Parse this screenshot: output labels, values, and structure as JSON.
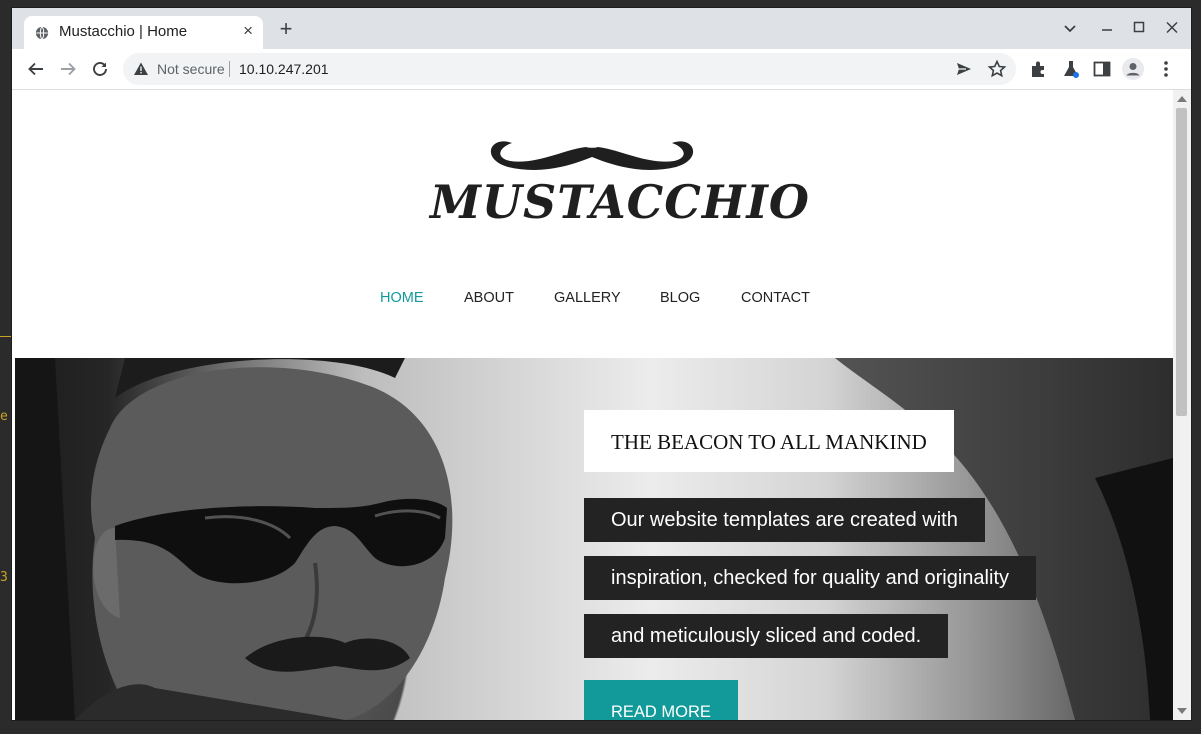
{
  "browser": {
    "tab_title": "Mustacchio | Home",
    "tab_close": "×",
    "new_tab": "+",
    "security_label": "Not secure",
    "url": "10.10.247.201"
  },
  "site": {
    "logo_text": "MUSTACCHIO",
    "nav": [
      {
        "label": "HOME",
        "active": true
      },
      {
        "label": "ABOUT",
        "active": false
      },
      {
        "label": "GALLERY",
        "active": false
      },
      {
        "label": "BLOG",
        "active": false
      },
      {
        "label": "CONTACT",
        "active": false
      }
    ],
    "hero": {
      "title": "THE BEACON TO ALL MANKIND",
      "lines": [
        "Our website templates are created with",
        "inspiration, checked for quality and originality",
        "and meticulously sliced and coded."
      ],
      "button": "READ MORE"
    }
  },
  "desktop": {
    "edge_text_1": "e",
    "edge_text_2": "3"
  },
  "colors": {
    "accent": "#129a9a",
    "dark_box": "#232323",
    "tabstrip": "#dee1e6"
  },
  "icons": {
    "favicon": "globe-icon",
    "back": "arrow-left-icon",
    "forward": "arrow-right-icon",
    "reload": "reload-icon",
    "warning": "warning-icon",
    "share": "send-icon",
    "bookmark": "star-icon",
    "extensions": "puzzle-icon",
    "labs": "flask-icon",
    "sidepanel": "side-panel-icon",
    "profile": "avatar-icon",
    "menu": "kebab-menu-icon"
  }
}
